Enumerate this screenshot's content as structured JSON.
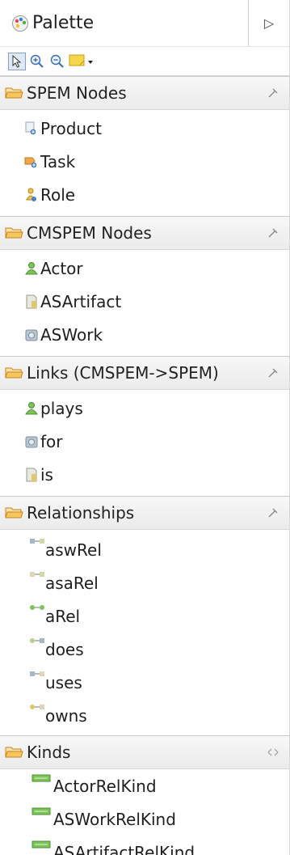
{
  "palette": {
    "title": "Palette",
    "collapse_arrow": "▷"
  },
  "toolbar": {
    "tools": [
      "select-icon",
      "zoom-in-icon",
      "zoom-out-icon",
      "note-icon"
    ]
  },
  "drawers": [
    {
      "title": "SPEM Nodes",
      "items": [
        {
          "label": "Product",
          "icon": "product-icon"
        },
        {
          "label": "Task",
          "icon": "task-icon"
        },
        {
          "label": "Role",
          "icon": "role-icon"
        }
      ]
    },
    {
      "title": "CMSPEM Nodes",
      "items": [
        {
          "label": "Actor",
          "icon": "actor-icon"
        },
        {
          "label": "ASArtifact",
          "icon": "artifact-icon"
        },
        {
          "label": "ASWork",
          "icon": "work-icon"
        }
      ]
    },
    {
      "title": "Links (CMSPEM->SPEM)",
      "items": [
        {
          "label": "plays",
          "icon": "actor-icon"
        },
        {
          "label": "for",
          "icon": "work-icon"
        },
        {
          "label": "is",
          "icon": "artifact-icon"
        }
      ]
    },
    {
      "title": "Relationships",
      "items": [
        {
          "label": "aswRel",
          "icon": "relation-icon"
        },
        {
          "label": "asaRel",
          "icon": "relation-icon"
        },
        {
          "label": "aRel",
          "icon": "relation-icon"
        },
        {
          "label": "does",
          "icon": "relation-icon"
        },
        {
          "label": "uses",
          "icon": "relation-icon"
        },
        {
          "label": "owns",
          "icon": "relation-icon"
        }
      ]
    },
    {
      "title": "Kinds",
      "items": [
        {
          "label": "ActorRelKind",
          "icon": "kind-icon"
        },
        {
          "label": "ASWorkRelKind",
          "icon": "kind-icon"
        },
        {
          "label": "ASArtifactRelKind",
          "icon": "kind-icon"
        }
      ]
    }
  ],
  "colors": {
    "folder": "#e8a535",
    "actor_green": "#5a9e3a",
    "work_gray": "#8c9aa8",
    "kind_green": "#5fa84a"
  }
}
